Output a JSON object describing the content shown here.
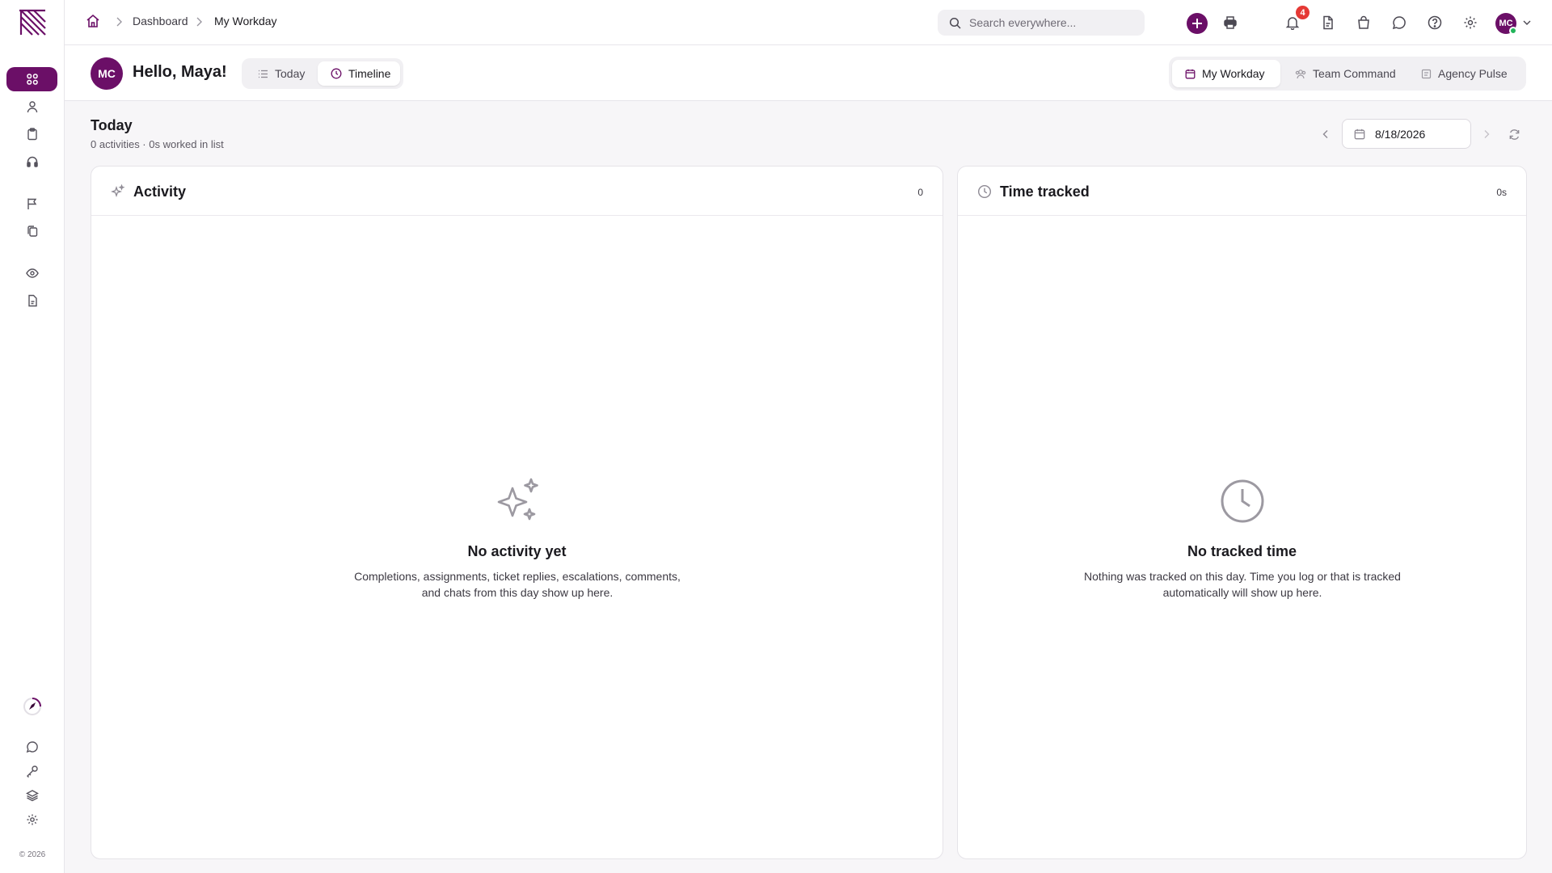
{
  "breadcrumb": {
    "root": "Dashboard",
    "current": "My Workday"
  },
  "search": {
    "placeholder": "Search everywhere..."
  },
  "notifications": {
    "count": "4"
  },
  "user": {
    "initials": "MC",
    "greeting": "Hello, Maya!"
  },
  "view_tabs": {
    "today": "Today",
    "timeline": "Timeline",
    "active": "Timeline"
  },
  "workspace_tabs": {
    "my_workday": "My Workday",
    "team_command": "Team Command",
    "agency_pulse": "Agency Pulse",
    "active": "My Workday"
  },
  "day": {
    "title": "Today",
    "summary": "0 activities · 0s worked in list",
    "date": "8/18/2026"
  },
  "activity": {
    "title": "Activity",
    "count": "0",
    "empty_title": "No activity yet",
    "empty_text": "Completions, assignments, ticket replies, escalations, comments, and chats from this day show up here."
  },
  "time_tracked": {
    "title": "Time tracked",
    "count": "0s",
    "empty_title": "No tracked time",
    "empty_text": "Nothing was tracked on this day. Time you log or that is tracked automatically will show up here."
  },
  "footer": {
    "copyright": "© 2026"
  },
  "colors": {
    "brand": "#6b0f67",
    "badge": "#e53935",
    "online": "#22b45a"
  },
  "icons": [
    "logo-icon",
    "grid-icon",
    "user-icon",
    "clipboard-icon",
    "headset-icon",
    "flag-icon",
    "copy-icon",
    "eye-icon",
    "report-icon",
    "rocket-icon",
    "chat-icon",
    "key-icon",
    "stack-icon",
    "gear-icon",
    "home-icon",
    "search-icon",
    "printer-icon",
    "plus-icon",
    "bell-icon",
    "document-icon",
    "bag-icon",
    "help-icon",
    "chevron-down-icon",
    "calendar-icon",
    "refresh-icon",
    "sparkle-icon",
    "clock-icon",
    "list-icon"
  ]
}
